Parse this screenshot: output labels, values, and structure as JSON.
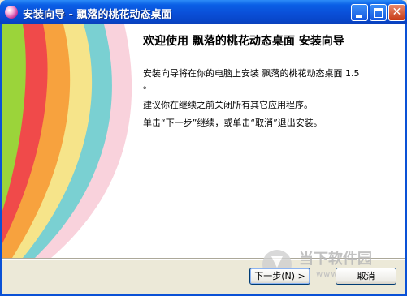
{
  "window": {
    "title": "安装向导 - 飘落的桃花动态桌面",
    "close_glyph": "✕"
  },
  "main": {
    "heading": "欢迎使用 飘落的桃花动态桌面 安装向导",
    "paragraph1": "安装向导将在你的电脑上安装 飘落的桃花动态桌面 1.5",
    "paragraph1_end": "。",
    "paragraph2": "建议你在继续之前关闭所有其它应用程序。",
    "paragraph3": "单击“下一步”继续，或单击“取消”退出安装。"
  },
  "buttons": {
    "next": "下一步(N) >",
    "cancel": "取消"
  },
  "watermark": {
    "text": "当下软件园",
    "url": "www.xiazai.com"
  },
  "colors": {
    "titlebar": "#0a4fd8",
    "sidebar_petals": [
      "#9bd43a",
      "#f04a4a",
      "#f7a23e",
      "#f5e07a",
      "#6fcfd2",
      "#f7b6c8"
    ]
  }
}
